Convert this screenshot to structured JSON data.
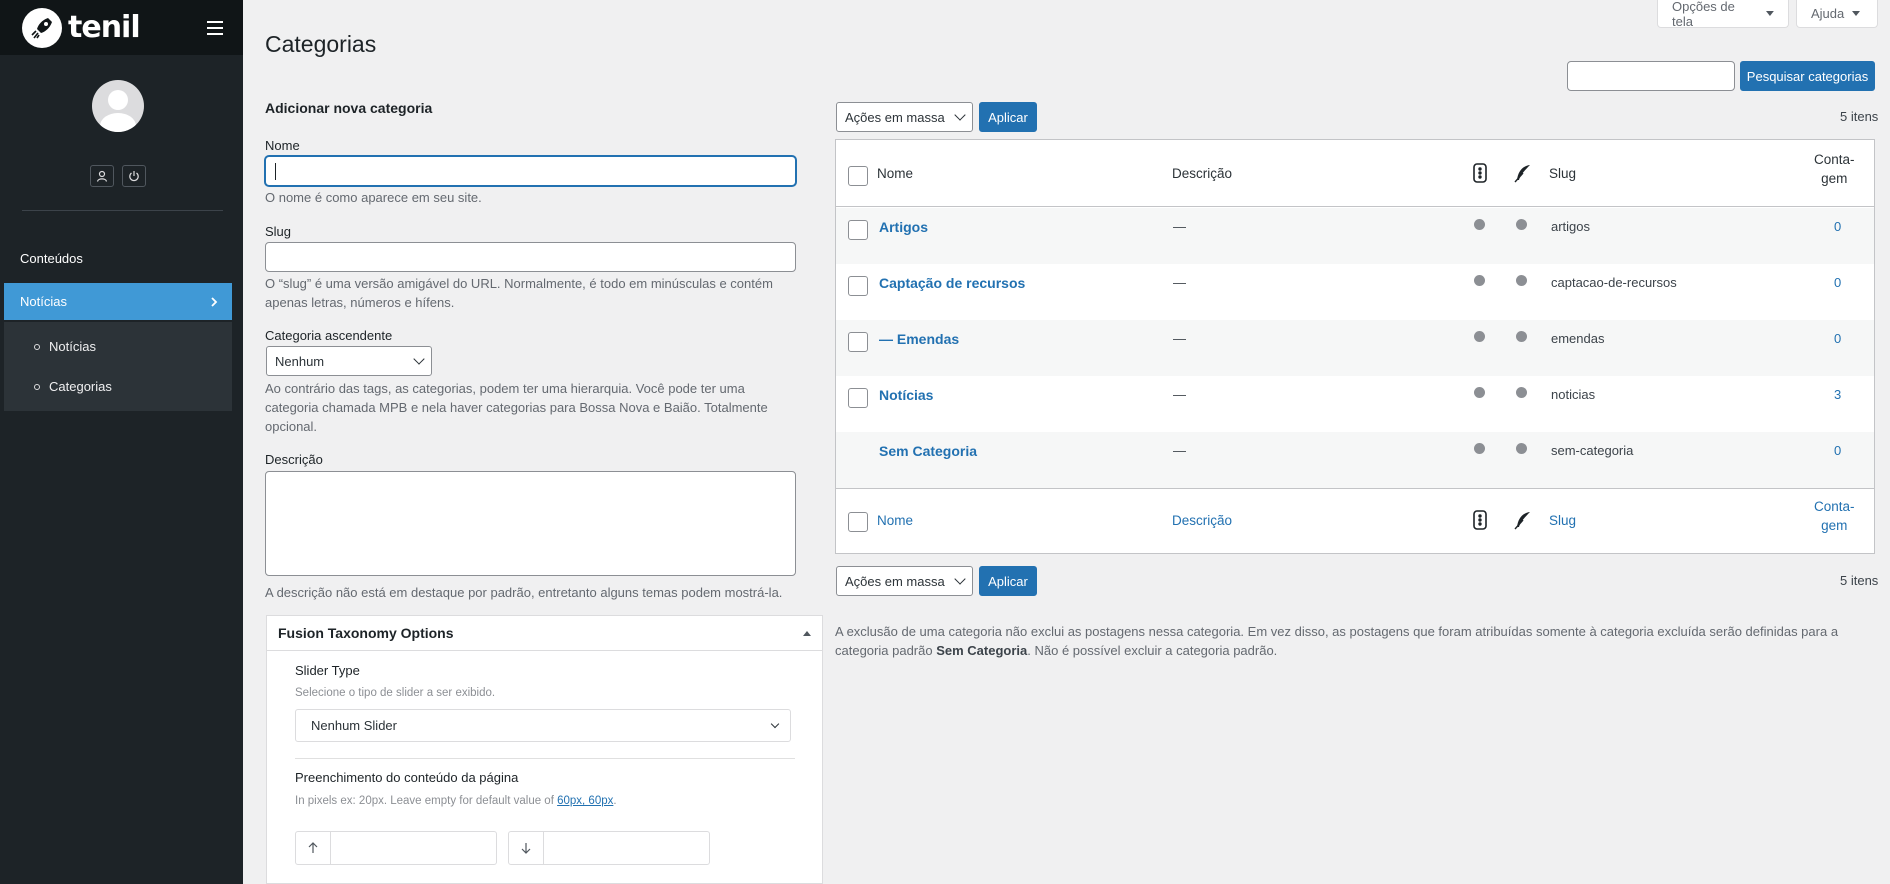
{
  "brand": {
    "logo_text": "tenil"
  },
  "sidebar": {
    "menu_head": "Conteúdos",
    "active_item": "Notícias",
    "sub_items": [
      {
        "label": "Notícias"
      },
      {
        "label": "Categorias"
      }
    ]
  },
  "topbar": {
    "screen_options": "Opções de tela",
    "help": "Ajuda"
  },
  "page": {
    "title": "Categorias"
  },
  "form": {
    "heading": "Adicionar nova categoria",
    "name_label": "Nome",
    "name_value": "",
    "name_hint": "O nome é como aparece em seu site.",
    "slug_label": "Slug",
    "slug_value": "",
    "slug_hint_1": "O “slug” é uma versão amigável do URL. Normalmente, é todo em minúsculas e contém",
    "slug_hint_2": "apenas letras, números e hífens.",
    "parent_label": "Categoria ascendente",
    "parent_value": "Nenhum",
    "parent_hint_1": "Ao contrário das tags, as categorias, podem ter uma hierarquia. Você pode ter uma",
    "parent_hint_2": "categoria chamada MPB e nela haver categorias para Bossa Nova e Baião. Totalmente",
    "parent_hint_3": "opcional.",
    "desc_label": "Descrição",
    "desc_value": "",
    "desc_hint": "A descrição não está em destaque por padrão, entretanto alguns temas podem mostrá-la."
  },
  "fusion": {
    "title": "Fusion Taxonomy Options",
    "slider_label": "Slider Type",
    "slider_hint": "Selecione o tipo de slider a ser exibido.",
    "slider_value": "Nenhum Slider",
    "padding_label": "Preenchimento do conteúdo da página",
    "padding_hint": "In pixels ex: 20px. Leave empty for default value of",
    "padding_default": "60px, 60px",
    "padding_hint_end": ".",
    "padding_top_value": "",
    "padding_bottom_value": ""
  },
  "search": {
    "value": "",
    "button": "Pesquisar categorias"
  },
  "bulk": {
    "select": "Ações em massa",
    "apply": "Aplicar",
    "count": "5 itens"
  },
  "table": {
    "headers": {
      "name": "Nome",
      "description": "Descrição",
      "slug": "Slug",
      "count_1": "Conta-",
      "count_2": "gem"
    },
    "rows": [
      {
        "name": "Artigos",
        "description": "—",
        "slug": "artigos",
        "count": "0"
      },
      {
        "name": "Captação de recursos",
        "description": "—",
        "slug": "captacao-de-recursos",
        "count": "0"
      },
      {
        "name": "— Emendas",
        "description": "—",
        "slug": "emendas",
        "count": "0"
      },
      {
        "name": "Notícias",
        "description": "—",
        "slug": "noticias",
        "count": "3"
      },
      {
        "name": "Sem Categoria",
        "description": "—",
        "slug": "sem-categoria",
        "count": "0"
      }
    ]
  },
  "note": {
    "text_1": "A exclusão de uma categoria não exclui as postagens nessa categoria. Em vez disso, as postagens que foram atribuídas somente à categoria excluída serão definidas para a categoria",
    "text_2a": "padrão",
    "text_2b": "Sem Categoria",
    "text_2c": ". Não é possível excluir a categoria padrão."
  },
  "colors": {
    "sidebar": "#1d2327",
    "accent": "#2271b1",
    "active": "#4099d6"
  }
}
